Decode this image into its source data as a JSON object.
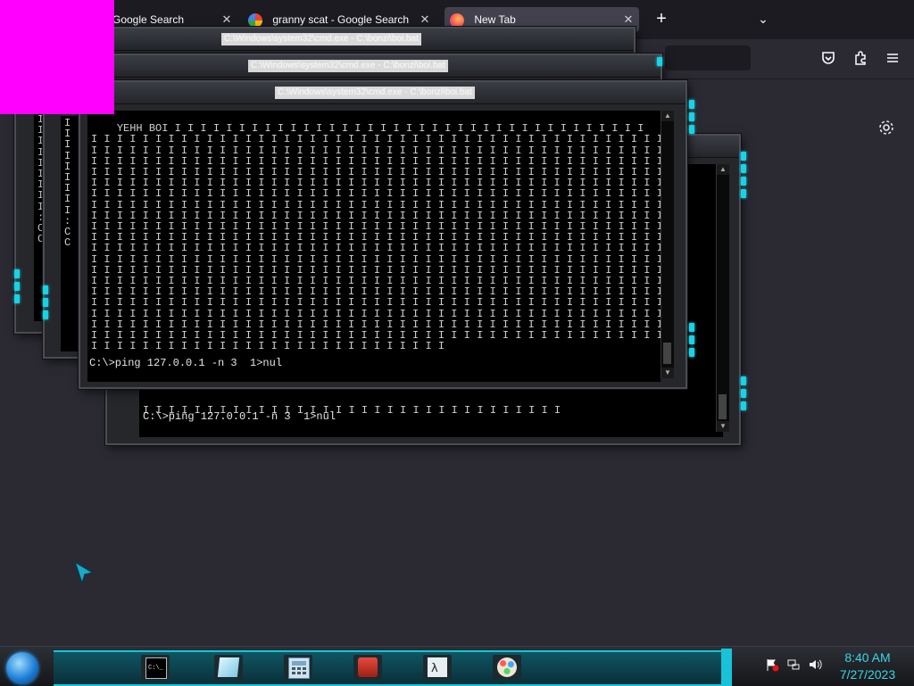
{
  "browser": {
    "tabs": [
      {
        "label": "Google Search",
        "favicon": "google-icon",
        "close": "✕"
      },
      {
        "label": "granny scat - Google Search",
        "favicon": "google-icon",
        "close": "✕"
      },
      {
        "label": "New Tab",
        "favicon": "firefox-icon",
        "close": "✕",
        "active": true
      }
    ],
    "new_tab_glyph": "+",
    "tab_list_glyph": "⌄"
  },
  "consoles": {
    "title": "C:\\Windows\\system32\\cmd.exe - C:\\bonzi\\boi.bat",
    "first_line_prefix": "YEHH BO",
    "fill_char": "I",
    "prompt": "C:\\>ping 127.0.0.1 -n 3  1>nul",
    "left_strip_chars": [
      "I",
      "I",
      "I",
      "I",
      "I",
      "I",
      "I",
      "I",
      "I",
      ":",
      "C",
      "C"
    ]
  },
  "taskbar": {
    "time": "8:40 AM",
    "date": "7/27/2023",
    "pinned": [
      "cmd-icon",
      "notes-icon",
      "calculator-icon",
      "toolbox-icon",
      "terminal-icon",
      "paint-icon"
    ]
  },
  "colors": {
    "accent_cyan": "#19d2e6",
    "console_bg": "#000000",
    "desktop_bg": "#2b2a33",
    "overlay_magenta": "#ff00ff"
  }
}
